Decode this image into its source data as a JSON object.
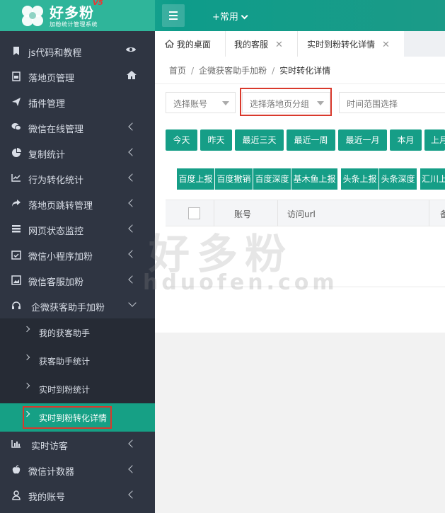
{
  "header": {
    "app_title": "好多粉",
    "app_sup": "V5",
    "app_subtitle": "加粉统计管理系统",
    "common_menu": "+常用"
  },
  "sidebar": {
    "items": [
      {
        "label": "js代码和教程",
        "icon": "bookmark-icon",
        "right_icon": "eye-icon"
      },
      {
        "label": "落地页管理",
        "icon": "page-icon",
        "right_icon": "home-icon"
      },
      {
        "label": "插件管理",
        "icon": "send-icon"
      },
      {
        "label": "微信在线管理",
        "icon": "wechat-icon"
      },
      {
        "label": "复制统计",
        "icon": "pie-chart-icon"
      },
      {
        "label": "行为转化统计",
        "icon": "line-chart-icon"
      },
      {
        "label": "落地页跳转管理",
        "icon": "share-arrow-icon"
      },
      {
        "label": "网页状态监控",
        "icon": "server-icon"
      },
      {
        "label": "微信小程序加粉",
        "icon": "calendar-icon"
      },
      {
        "label": "微信客服加粉",
        "icon": "image-icon"
      },
      {
        "label": "企微获客助手加粉",
        "icon": "headset-icon"
      }
    ],
    "sub_items": [
      {
        "label": "我的获客助手"
      },
      {
        "label": "获客助手统计"
      },
      {
        "label": "实时到粉统计"
      },
      {
        "label": "实时到粉转化详情"
      }
    ],
    "bottom_items": [
      {
        "label": "实时访客",
        "icon": "bar-chart-icon"
      },
      {
        "label": "微信计数器",
        "icon": "apple-icon"
      },
      {
        "label": "我的账号",
        "icon": "user-icon"
      }
    ]
  },
  "tabs": [
    {
      "label": "我的桌面",
      "icon": "home-outline-icon"
    },
    {
      "label": "我的客服"
    },
    {
      "label": "实时到粉转化详情"
    }
  ],
  "tab_close": "✕",
  "breadcrumb": {
    "home": "首页",
    "parent": "企微获客助手加粉",
    "current": "实时转化详情",
    "sep": "/"
  },
  "filters": {
    "account": "选择账号",
    "landing_group": "选择落地页分组",
    "time_range": "时间范围选择"
  },
  "date_buttons": [
    "今天",
    "昨天",
    "最近三天",
    "最近一周",
    "最近一月",
    "本月",
    "上月"
  ],
  "report_buttons": [
    "百度上报",
    "百度撤销",
    "百度深度",
    "基木鱼上报",
    "头条上报",
    "头条深度",
    "汇川上"
  ],
  "table": {
    "columns": [
      "账号",
      "访问url",
      "备"
    ]
  },
  "watermark": {
    "text": "好多粉",
    "domain": "hduofen.com"
  },
  "colors": {
    "accent": "#169e87",
    "sidebar_bg": "#2f3542",
    "highlight": "#d9392c"
  }
}
